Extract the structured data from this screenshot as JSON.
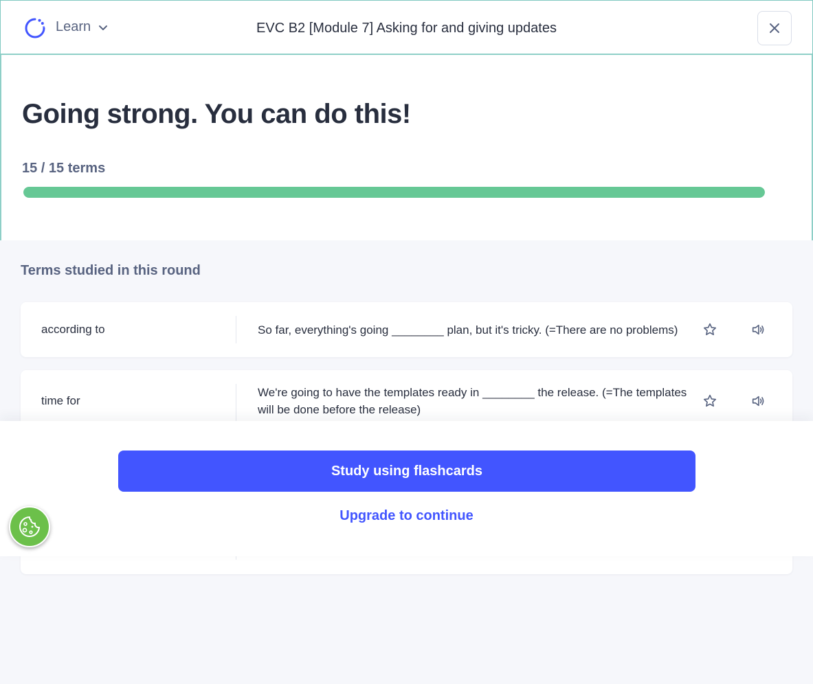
{
  "header": {
    "mode_label": "Learn",
    "title": "EVC B2 [Module 7] Asking for and giving updates"
  },
  "summary": {
    "headline": "Going strong. You can do this!",
    "progress_text": "15 / 15 terms",
    "progress_fraction": 1.0
  },
  "terms_section": {
    "label": "Terms studied in this round",
    "items": [
      {
        "term": "according to",
        "definition": "So far, everything's going ________ plan, but it's tricky. (=There are no problems)"
      },
      {
        "term": "time for",
        "definition": "We're going to have the templates ready in ________ the release. (=The templates will be done before the release)"
      }
    ]
  },
  "actions": {
    "primary": "Study using flashcards",
    "secondary": "Upgrade to continue"
  },
  "colors": {
    "accent": "#4255ff",
    "progress": "#66c895",
    "cookie": "#6cc04a"
  }
}
